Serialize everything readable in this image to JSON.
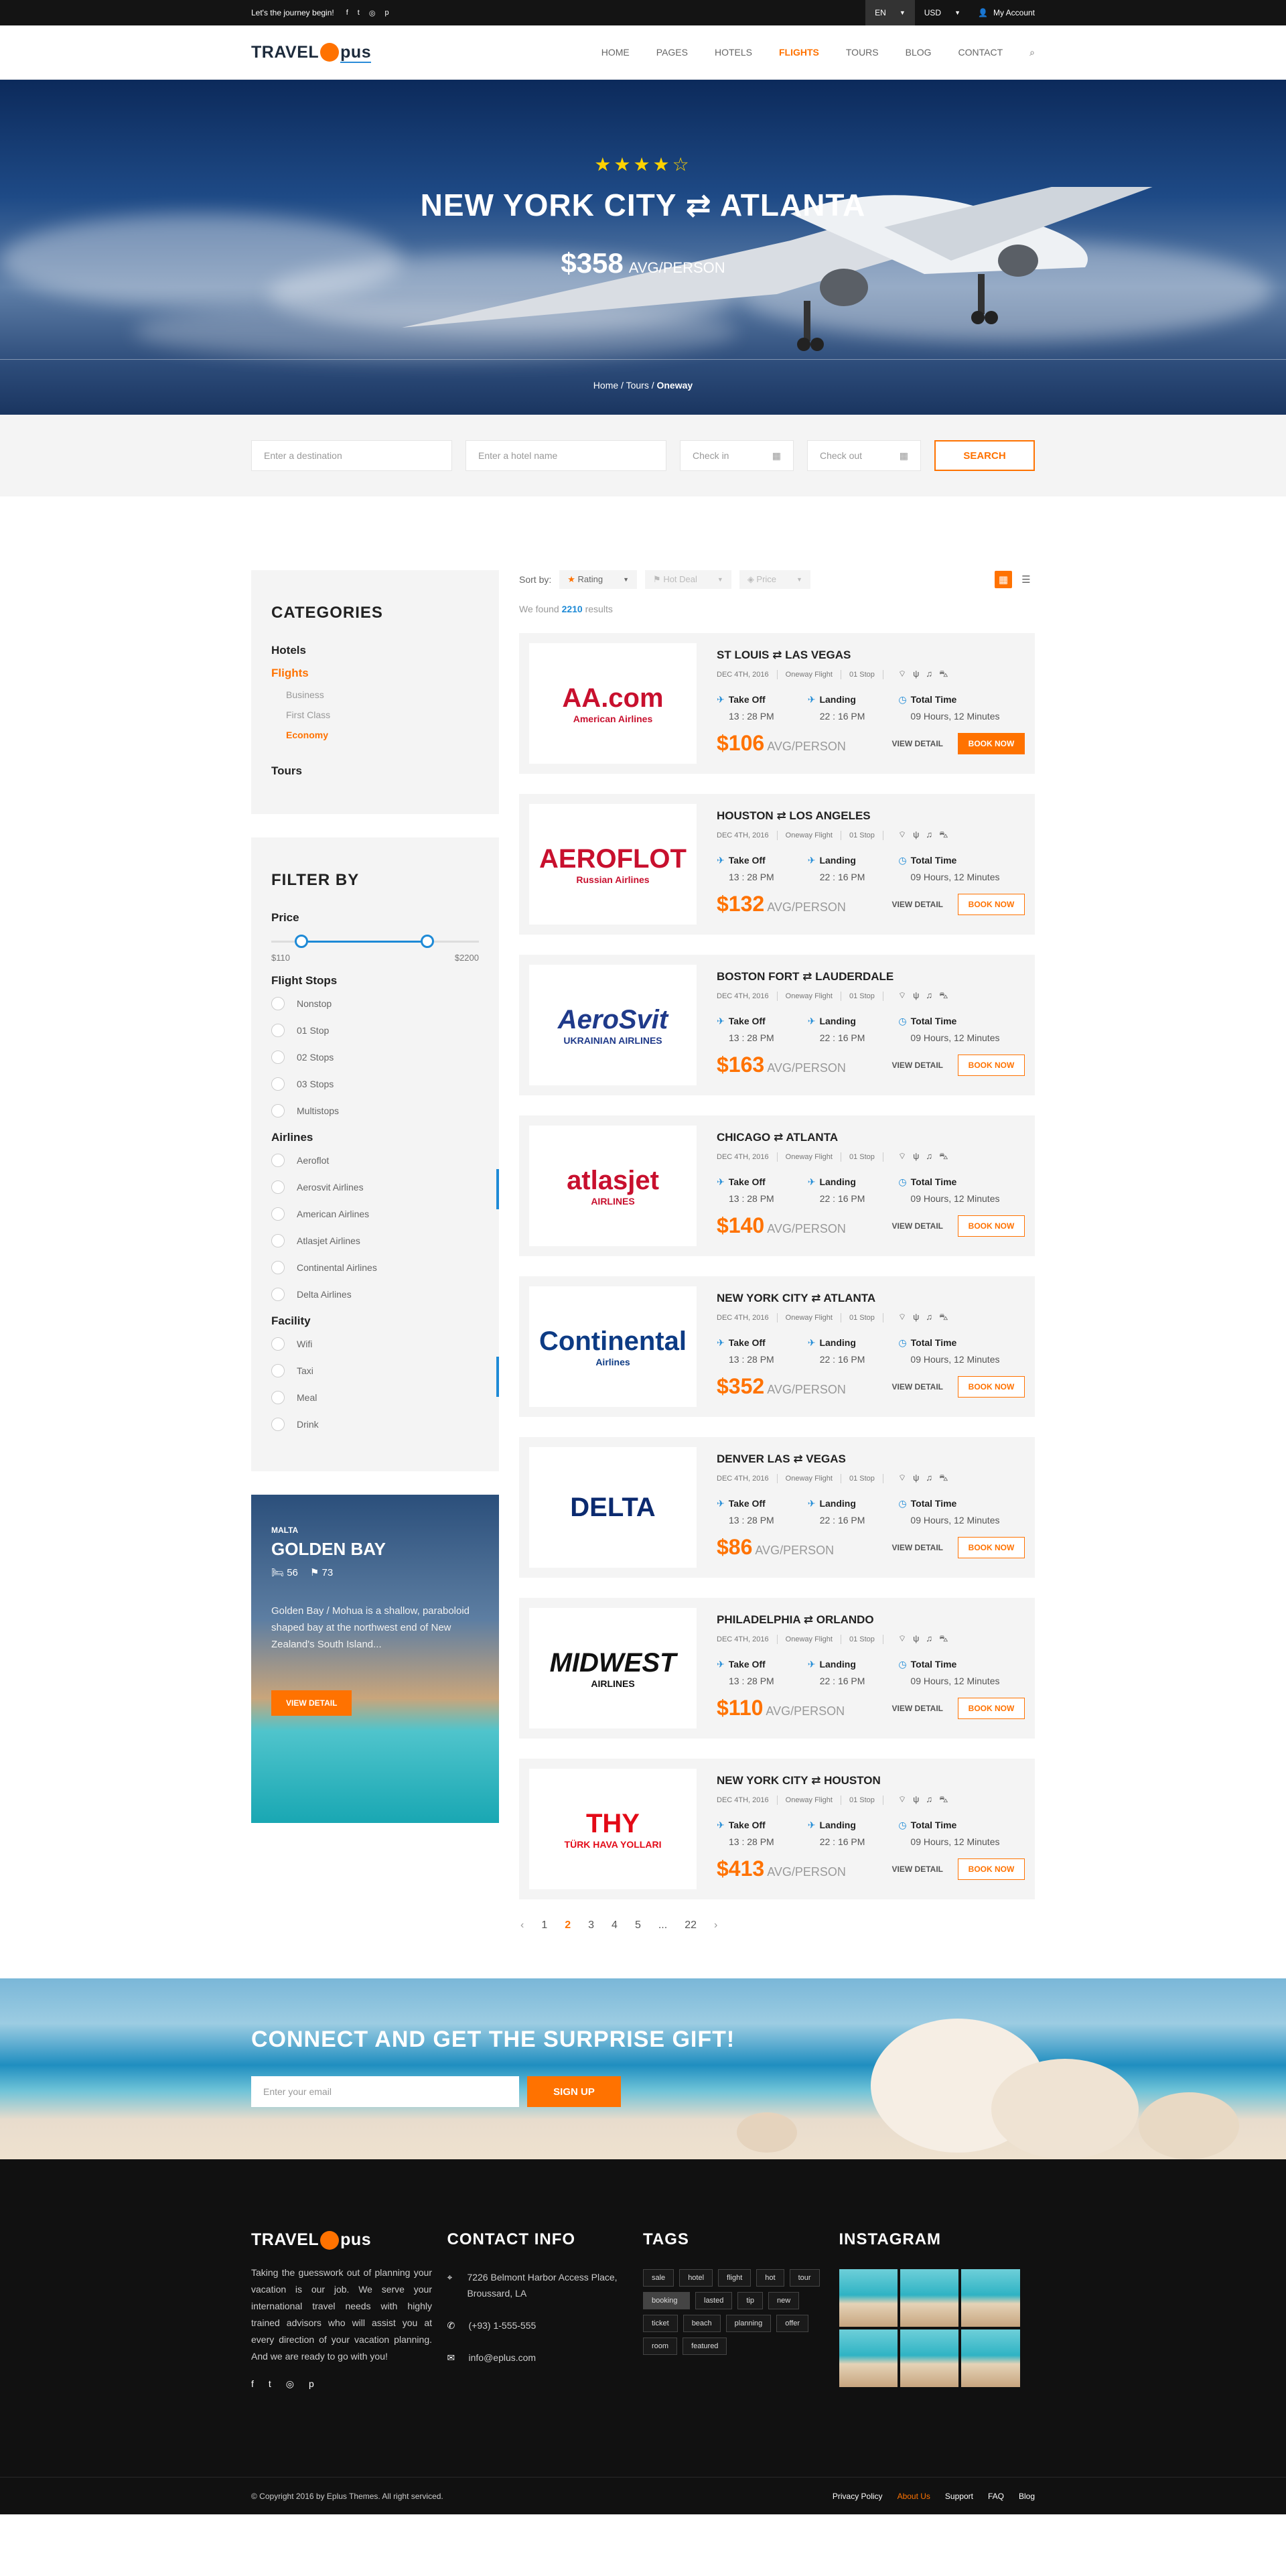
{
  "topbar": {
    "tagline": "Let's the journey begin!",
    "social": [
      "f",
      "t",
      "◎",
      "p"
    ],
    "lang": "EN",
    "currency": "USD",
    "account": "My Account"
  },
  "brand": {
    "left": "TRAVEL",
    "right": "pus"
  },
  "nav": [
    "HOME",
    "PAGES",
    "HOTELS",
    "FLIGHTS",
    "TOURS",
    "BLOG",
    "CONTACT"
  ],
  "nav_active": "FLIGHTS",
  "hero": {
    "stars": "★★★★☆",
    "from": "NEW YORK CITY",
    "to": "ATLANTA",
    "arrow": "⇄",
    "price": "$358",
    "per": "AVG/PERSON",
    "crumbs": [
      "Home",
      "Tours",
      "Oneway"
    ]
  },
  "search": {
    "destination": "Enter a destination",
    "hotel": "Enter a hotel name",
    "checkin": "Check in",
    "checkout": "Check out",
    "button": "SEARCH"
  },
  "categories": {
    "title": "CATEGORIES",
    "items": [
      "Hotels",
      "Flights",
      "Tours"
    ],
    "flight_sub": [
      "Business",
      "First Class",
      "Economy"
    ]
  },
  "filter": {
    "title": "FILTER BY",
    "price": "Price",
    "min": "$110",
    "max": "$2200",
    "price_range": [
      0.12,
      0.77
    ],
    "stops_title": "Flight Stops",
    "stops": [
      "Nonstop",
      "01 Stop",
      "02 Stops",
      "03 Stops",
      "Multistops"
    ],
    "airlines_title": "Airlines",
    "airlines": [
      "Aeroflot",
      "Aerosvit Airlines",
      "American Airlines",
      "Atlasjet Airlines",
      "Continental Airlines",
      "Delta Airlines"
    ],
    "facility_title": "Facility",
    "facility": [
      "Wifi",
      "Taxi",
      "Meal",
      "Drink"
    ]
  },
  "promo": {
    "country": "MALTA",
    "name": "GOLDEN BAY",
    "beds": "56",
    "flags": "73",
    "desc": "Golden Bay / Mohua is a shallow, paraboloid shaped bay at the northwest end of New Zealand's South Island...",
    "button": "VIEW DETAIL"
  },
  "sort": {
    "label": "Sort by:",
    "rating": "Rating",
    "deal": "Hot Deal",
    "price": "Price"
  },
  "found": {
    "pre": "We found",
    "count": "2210",
    "post": "results"
  },
  "flights": [
    {
      "from": "ST LOUIS",
      "to": "LAS VEGAS",
      "date": "DEC 4TH, 2016",
      "type": "Oneway Flight",
      "stop": "01 Stop",
      "off": "13 : 28 PM",
      "land": "22 : 16 PM",
      "total": "09 Hours, 12 Minutes",
      "price": "$106",
      "logo": "AA.com",
      "logo2": "American Airlines",
      "color": "#c8102e",
      "booked": true
    },
    {
      "from": "HOUSTON",
      "to": "LOS ANGELES",
      "date": "DEC 4TH, 2016",
      "type": "Oneway Flight",
      "stop": "01 Stop",
      "off": "13 : 28 PM",
      "land": "22 : 16 PM",
      "total": "09 Hours, 12 Minutes",
      "price": "$132",
      "logo": "AEROFLOT",
      "logo2": "Russian Airlines",
      "color": "#c8102e",
      "booked": false
    },
    {
      "from": "BOSTON FORT",
      "to": "LAUDERDALE",
      "date": "DEC 4TH, 2016",
      "type": "Oneway Flight",
      "stop": "01 Stop",
      "off": "13 : 28 PM",
      "land": "22 : 16 PM",
      "total": "09 Hours, 12 Minutes",
      "price": "$163",
      "logo": "AeroSvit",
      "logo2": "UKRAINIAN AIRLINES",
      "color": "#1f3a8a",
      "booked": false
    },
    {
      "from": "CHICAGO",
      "to": "ATLANTA",
      "date": "DEC 4TH, 2016",
      "type": "Oneway Flight",
      "stop": "01 Stop",
      "off": "13 : 28 PM",
      "land": "22 : 16 PM",
      "total": "09 Hours, 12 Minutes",
      "price": "$140",
      "logo": "atlasjet",
      "logo2": "AIRLINES",
      "color": "#c8102e",
      "booked": false
    },
    {
      "from": "NEW YORK CITY",
      "to": "ATLANTA",
      "date": "DEC 4TH, 2016",
      "type": "Oneway Flight",
      "stop": "01 Stop",
      "off": "13 : 28 PM",
      "land": "22 : 16 PM",
      "total": "09 Hours, 12 Minutes",
      "price": "$352",
      "logo": "Continental",
      "logo2": "Airlines",
      "color": "#0d3b84",
      "booked": false
    },
    {
      "from": "DENVER LAS",
      "to": "VEGAS",
      "date": "DEC 4TH, 2016",
      "type": "Oneway Flight",
      "stop": "01 Stop",
      "off": "13 : 28 PM",
      "land": "22 : 16 PM",
      "total": "09 Hours, 12 Minutes",
      "price": "$86",
      "logo": "DELTA",
      "logo2": "",
      "color": "#0b2a6f",
      "booked": false
    },
    {
      "from": "PHILADELPHIA",
      "to": "ORLANDO",
      "date": "DEC 4TH, 2016",
      "type": "Oneway Flight",
      "stop": "01 Stop",
      "off": "13 : 28 PM",
      "land": "22 : 16 PM",
      "total": "09 Hours, 12 Minutes",
      "price": "$110",
      "logo": "MIDWEST",
      "logo2": "AIRLINES",
      "color": "#111111",
      "booked": false
    },
    {
      "from": "NEW YORK CITY",
      "to": "HOUSTON",
      "date": "DEC 4TH, 2016",
      "type": "Oneway Flight",
      "stop": "01 Stop",
      "off": "13 : 28 PM",
      "land": "22 : 16 PM",
      "total": "09 Hours, 12 Minutes",
      "price": "$413",
      "logo": "THY",
      "logo2": "TÜRK HAVA YOLLARI",
      "color": "#e30a17",
      "booked": false
    }
  ],
  "labels": {
    "takeoff": "Take Off",
    "landing": "Landing",
    "total": "Total Time",
    "per": "AVG/PERSON",
    "detail": "VIEW DETAIL",
    "book": "BOOK NOW"
  },
  "pager": {
    "prev": "‹",
    "pages": [
      "1",
      "2",
      "3",
      "4",
      "5",
      "...",
      "22"
    ],
    "active": "2",
    "next": "›"
  },
  "newsletter": {
    "title": "CONNECT AND GET THE SURPRISE GIFT!",
    "placeholder": "Enter your email",
    "button": "SIGN UP"
  },
  "footer": {
    "about": "Taking the guesswork out of planning your vacation is our job. We serve your international travel needs with highly trained advisors who will assist you at every direction of your vacation planning. And we are ready to go with you!",
    "social": [
      "f",
      "t",
      "◎",
      "p"
    ],
    "contact_title": "CONTACT INFO",
    "address": "7226 Belmont Harbor Access Place, Broussard, LA",
    "phone": "(+93) 1-555-555",
    "email": "info@eplus.com",
    "tags_title": "TAGS",
    "tags": [
      "sale",
      "hotel",
      "flight",
      "hot",
      "tour",
      "booking",
      "lasted",
      "tip",
      "new",
      "ticket",
      "beach",
      "planning",
      "offer",
      "room",
      "featured"
    ],
    "insta_title": "INSTAGRAM",
    "copyright": "© Copyright 2016 by Eplus Themes. All right serviced.",
    "links": [
      "Privacy Policy",
      "About Us",
      "Support",
      "FAQ",
      "Blog"
    ]
  }
}
